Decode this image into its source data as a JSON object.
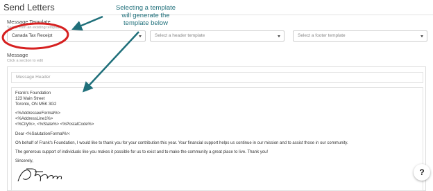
{
  "page": {
    "title": "Send Letters"
  },
  "message_template": {
    "label": "Message Template",
    "hint": "Select from an existing template",
    "template_value": "Canada Tax Receipt",
    "header_placeholder": "Select a header template",
    "footer_placeholder": "Select a footer template"
  },
  "message": {
    "label": "Message",
    "hint": "Click a section to edit",
    "header_section": "Message Header",
    "body_lines": [
      "Frank's Foundation",
      "123 Main Street",
      "Toronto, ON M5K 3G2",
      "<%AddresseeFormal%>",
      "<%AddressLine1%>",
      "<%City%>, <%State%> <%PostalCode%>",
      "Dear <%SalutationFormal%>:",
      "Oh behalf of Frank's Foundation, I would like to thank you for your contribution this year. Your financial support helps us continue in our mission and to assist those in our community.",
      "The generous support of individuals like you makes it possible for us to exist and to make the community a great place to live. Thank you!",
      "Sincerely,"
    ],
    "signature": "F. Franklin"
  },
  "annotation": {
    "line1": "Selecting a template",
    "line2": "will generate the",
    "line3": "template below",
    "highlight_color": "#d62020",
    "arrow_color": "#1f6f7a"
  },
  "help": {
    "label": "?"
  }
}
